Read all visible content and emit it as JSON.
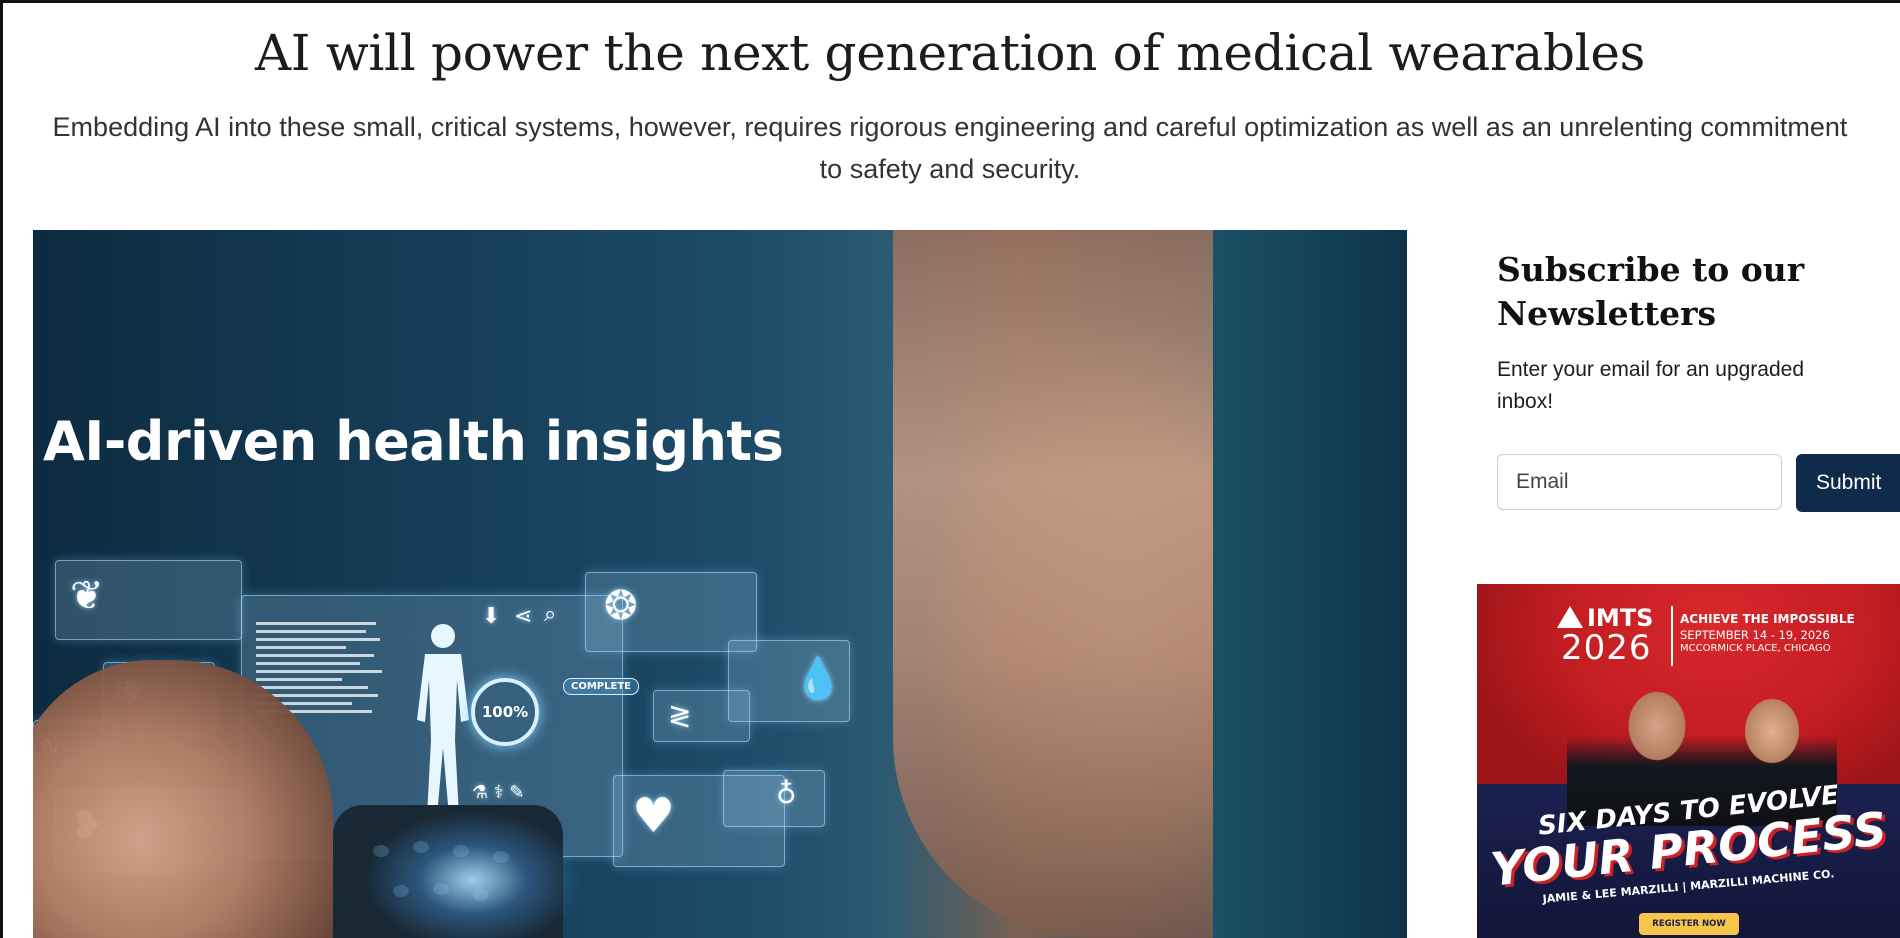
{
  "article": {
    "headline": "AI will power the next generation of medical wearables",
    "subheadline": "Embedding AI into these small, critical systems, however, requires rigorous engineering and careful optimization as well as an unrelenting commitment to safety and security."
  },
  "hero_image": {
    "overlay_text": "AI-driven health insights",
    "ring_value": "100%",
    "status_tag": "COMPLETE"
  },
  "newsletter": {
    "title": "Subscribe to our Newsletters",
    "description": "Enter your email for an upgraded inbox!",
    "email_placeholder": "Email",
    "submit_label": "Submit"
  },
  "advertisement": {
    "brand": "IMTS",
    "year": "2026",
    "tagline": "ACHIEVE THE IMPOSSIBLE",
    "dates": "SEPTEMBER 14 - 19, 2026",
    "venue": "MCCORMICK PLACE, CHICAGO",
    "slogan_line1": "SIX DAYS TO EVOLVE",
    "slogan_line2": "YOUR PROCESS",
    "credit": "JAMIE & LEE MARZILLI | MARZILLI MACHINE CO.",
    "cta_label": "REGISTER NOW"
  },
  "colors": {
    "submit_button": "#0f2a4a",
    "ad_red": "#c21d22",
    "ad_navy": "#1b2150",
    "ad_cta": "#f6c54a"
  }
}
